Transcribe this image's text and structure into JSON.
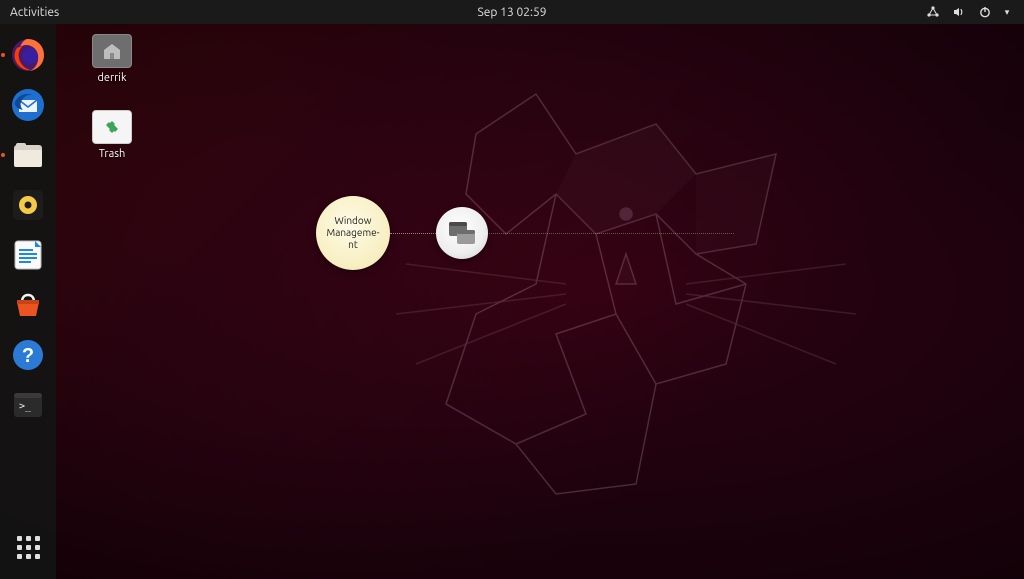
{
  "topbar": {
    "activities": "Activities",
    "datetime": "Sep 13  02:59"
  },
  "dock": {
    "items": [
      {
        "name": "firefox",
        "color": "#ff7139"
      },
      {
        "name": "thunderbird",
        "color": "#1f6fd0"
      },
      {
        "name": "files",
        "color": "#e6e6e6"
      },
      {
        "name": "rhythmbox",
        "color": "#1c1c1c"
      },
      {
        "name": "libreoffice-writer",
        "color": "#1e88e5"
      },
      {
        "name": "software",
        "color": "#e95420"
      },
      {
        "name": "help",
        "color": "#2b7bd6"
      },
      {
        "name": "terminal",
        "color": "#2b2b2b"
      }
    ]
  },
  "desktop": {
    "home_label": "derrik",
    "trash_label": "Trash"
  },
  "pie": {
    "label": "Window Manageme-nt"
  }
}
